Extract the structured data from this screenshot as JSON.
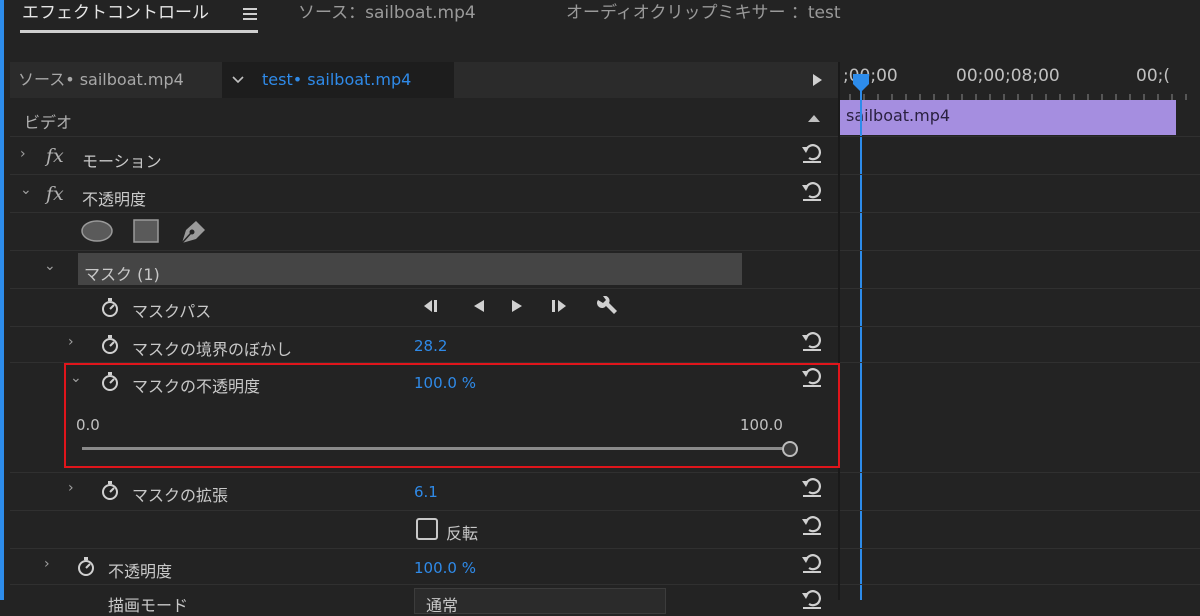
{
  "header": {
    "tabs": [
      {
        "label": "エフェクトコントロール",
        "active": true
      },
      {
        "label": "ソース：sailboat.mp4",
        "active": false
      },
      {
        "label": "オーディオクリップミキサー ：test",
        "active": false
      }
    ],
    "menu_icon": "hamburger-menu-icon"
  },
  "source_bar": {
    "source_label": "ソース• sailboat.mp4",
    "sequence_label": "test• sailboat.mp4",
    "dropdown_icon": "chevron-down-icon",
    "play_icon": "play-triangle-icon"
  },
  "timeline": {
    "ruler_labels": [
      ";00;00",
      "00;00;08;00",
      "00;("
    ],
    "clip_name": "sailboat.mp4",
    "playhead_color": "#2d8ceb",
    "clip_color": "#a58ee0"
  },
  "panel": {
    "section_label": "ビデオ",
    "motion_label": "モーション",
    "opacity_label": "不透明度",
    "fx_symbol": "fx",
    "mask_header": "マスク (1)",
    "mask_path_label": "マスクパス",
    "feather_label": "マスクの境界のぼかし",
    "feather_value": "28.2",
    "mask_opacity_label": "マスクの不透明度",
    "mask_opacity_value": "100.0 %",
    "slider_min": "0.0",
    "slider_max": "100.0",
    "slider_fraction": 1.0,
    "expansion_label": "マスクの拡張",
    "expansion_value": "6.1",
    "inverted_label": "反転",
    "opacity2_label": "不透明度",
    "opacity2_value": "100.0 %",
    "blend_label": "描画モード",
    "blend_value": "通常"
  },
  "colors": {
    "accent": "#2f8ae8",
    "highlight_border": "#e0151b"
  }
}
